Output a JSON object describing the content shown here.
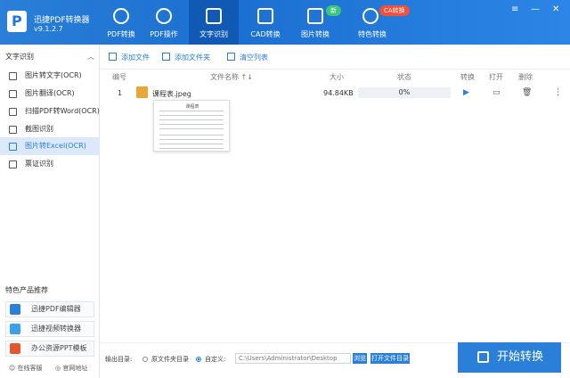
{
  "app": {
    "name": "迅捷PDF转换器",
    "version": "v9.1.2.7"
  },
  "tabs": [
    {
      "label": "PDF转换",
      "icon": "convert-icon"
    },
    {
      "label": "PDF操作",
      "icon": "pdf-operate-icon"
    },
    {
      "label": "文字识别",
      "icon": "ocr-icon"
    },
    {
      "label": "CAD转换",
      "icon": "cad-icon"
    },
    {
      "label": "图片转换",
      "icon": "image-icon"
    },
    {
      "label": "特色转换",
      "icon": "special-icon"
    }
  ],
  "badges": {
    "new": "新",
    "ca": "CA转换"
  },
  "window_controls": {
    "menu": "≡",
    "minimize": "—",
    "close": "✕"
  },
  "sidebar": {
    "header": "文字识别",
    "items": [
      {
        "label": "图片转文字(OCR)"
      },
      {
        "label": "图片翻译(OCR)"
      },
      {
        "label": "扫描PDF转Word(OCR)"
      },
      {
        "label": "截图识别"
      },
      {
        "label": "图片转Excel(OCR)"
      },
      {
        "label": "票证识别"
      }
    ],
    "featured_title": "特色产品推荐",
    "featured": [
      {
        "label": "迅捷PDF编辑器"
      },
      {
        "label": "迅捷视频转换器"
      },
      {
        "label": "办公资源PPT模板"
      }
    ],
    "footer": {
      "service": "在线客服",
      "site": "官网地址"
    }
  },
  "toolbar": {
    "add_file": "添加文件",
    "add_folder": "添加文件夹",
    "clear_list": "清空列表"
  },
  "table": {
    "headers": {
      "index": "编号",
      "name": "文件名称 ↑↓",
      "size": "大小",
      "status": "状态",
      "convert": "转换",
      "open": "打开",
      "delete": "删除"
    },
    "rows": [
      {
        "index": "1",
        "name": "课程表.jpeg",
        "size": "94.84KB",
        "progress_text": "0%",
        "progress": 0
      }
    ]
  },
  "preview_title": "课程表",
  "output": {
    "label": "输出目录:",
    "option_source": "原文件夹目录",
    "option_custom": "自定义:",
    "path": "C:\\Users\\Administrator\\Desktop",
    "browse": "浏览",
    "open_folder": "打开文件目录"
  },
  "start_button": "开始转换",
  "colors": {
    "accent": "#2a7fd8",
    "active_tab": "#1059b4",
    "new_badge": "#3cc67a",
    "ca_badge": "#f0503c"
  }
}
